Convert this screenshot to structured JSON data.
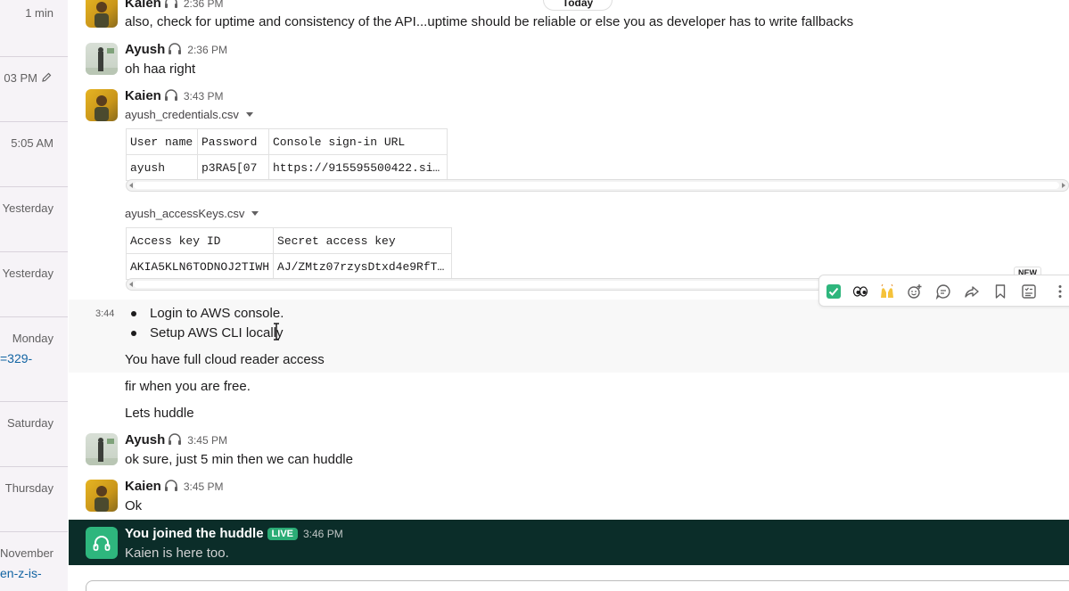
{
  "sidebar": {
    "items": [
      {
        "time": "1 min"
      },
      {
        "time": "03 PM"
      },
      {
        "time": "5:05 AM"
      },
      {
        "time": "Yesterday"
      },
      {
        "time": "Yesterday"
      },
      {
        "time": "Monday",
        "link": "=329-"
      },
      {
        "time": "Saturday"
      },
      {
        "time": "Thursday"
      },
      {
        "time": "November",
        "link": "en-z-is-"
      }
    ]
  },
  "divider": {
    "label": "Today"
  },
  "messages": [
    {
      "sender": "Kaien",
      "time": "2:36 PM",
      "text": "also, check for uptime and consistency of the API...uptime should be reliable or else you as developer has to write fallbacks"
    },
    {
      "sender": "Ayush",
      "time": "2:36 PM",
      "text": "oh haa right"
    },
    {
      "sender": "Kaien",
      "time": "3:43 PM"
    }
  ],
  "files": {
    "credentials": {
      "name": "ayush_credentials.csv",
      "headers": [
        "User name",
        "Password",
        "Console sign-in URL"
      ],
      "row": [
        "ayush",
        "p3RA5[07",
        "https://915595500422.si…"
      ]
    },
    "access_keys": {
      "name": "ayush_accessKeys.csv",
      "headers": [
        "Access key ID",
        "Secret access key"
      ],
      "row": [
        "AKIA5KLN6TODNOJ2TIWH",
        "AJ/ZMtz07rzysDtxd4e9RfT…"
      ]
    }
  },
  "list_message": {
    "time": "3:44",
    "items": [
      "Login to AWS console.",
      "Setup AWS CLI locally"
    ]
  },
  "followups": [
    "You have full cloud reader access",
    "fir when you are free.",
    "Lets huddle"
  ],
  "later_messages": [
    {
      "sender": "Ayush",
      "time": "3:45 PM",
      "text": "ok sure, just 5 min then we can huddle"
    },
    {
      "sender": "Kaien",
      "time": "3:45 PM",
      "text": "Ok"
    }
  ],
  "huddle": {
    "title": "You joined the huddle",
    "badge": "LIVE",
    "time": "3:46 PM",
    "subtitle": "Kaien is here too."
  },
  "toolbar": {
    "new_badge": "NEW",
    "icons": [
      "check-mark-emoji",
      "eyes-emoji",
      "raised-hands-emoji",
      "add-reaction-icon",
      "reply-in-thread-icon",
      "share-icon",
      "save-icon",
      "add-to-list-icon",
      "more-actions-icon"
    ]
  },
  "colors": {
    "huddle_bg": "#0b2d29",
    "live_green": "#2bac76",
    "link": "#1264a3"
  }
}
